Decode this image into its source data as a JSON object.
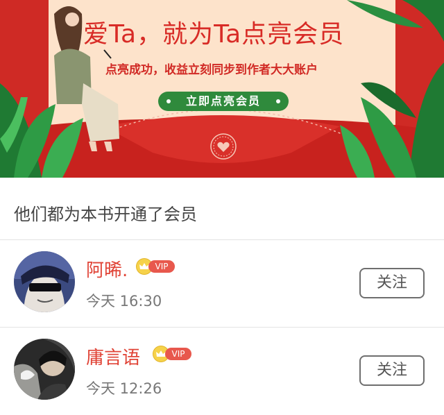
{
  "banner": {
    "headline": "爱Ta，就为Ta点亮会员",
    "subline": "点亮成功，收益立刻同步到作者大大账户",
    "cta_label": "立即点亮会员",
    "colors": {
      "red": "#cf2a25",
      "peach": "#fde3cb",
      "green": "#2f8a3c"
    }
  },
  "section": {
    "title": "他们都为本书开通了会员"
  },
  "members": [
    {
      "name": "阿晞.",
      "badge": "VIP",
      "time": "今天 16:30",
      "follow_label": "关注"
    },
    {
      "name": "庸言语",
      "badge": "VIP",
      "time": "今天 12:26",
      "follow_label": "关注"
    }
  ],
  "icons": [
    "heart-seal-icon",
    "crown-icon"
  ]
}
